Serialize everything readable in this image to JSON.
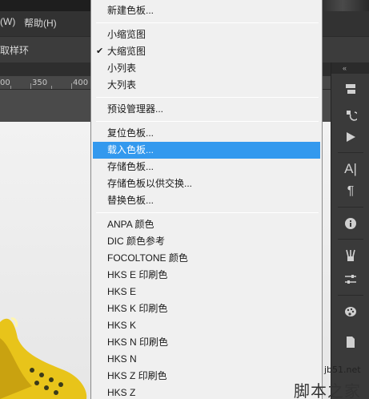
{
  "menubar": {
    "items": [
      "(W)",
      "帮助(H)"
    ]
  },
  "options_bar": {
    "label": "取样环"
  },
  "ruler": {
    "ticks": [
      "00",
      "350",
      "400"
    ]
  },
  "menu": {
    "checked_item": "大缩览图",
    "highlighted_item": "载入色板...",
    "groups": [
      [
        "新建色板..."
      ],
      [
        "小缩览图",
        "大缩览图",
        "小列表",
        "大列表"
      ],
      [
        "预设管理器..."
      ],
      [
        "复位色板...",
        "载入色板...",
        "存储色板...",
        "存储色板以供交换...",
        "替换色板..."
      ],
      [
        "ANPA 颜色",
        "DIC 颜色参考",
        "FOCOLTONE 颜色",
        "HKS E 印刷色",
        "HKS E",
        "HKS K 印刷色",
        "HKS K",
        "HKS N 印刷色",
        "HKS N",
        "HKS Z 印刷色",
        "HKS Z"
      ]
    ]
  },
  "right_panel": {
    "header_icon": "«",
    "icons": [
      "layers-3d-icon",
      "history-icon",
      "play-actions-icon",
      "character-icon",
      "paragraph-icon",
      "info-icon",
      "brushes-icon",
      "adjustments-icon",
      "palette-icon",
      "document-icon"
    ]
  },
  "watermark": {
    "url": "jb51.net",
    "text": "脚本之家"
  },
  "colors": {
    "highlight": "#3399ee",
    "menu_bg": "#f0f0f0",
    "chrome_dark": "#323232"
  }
}
